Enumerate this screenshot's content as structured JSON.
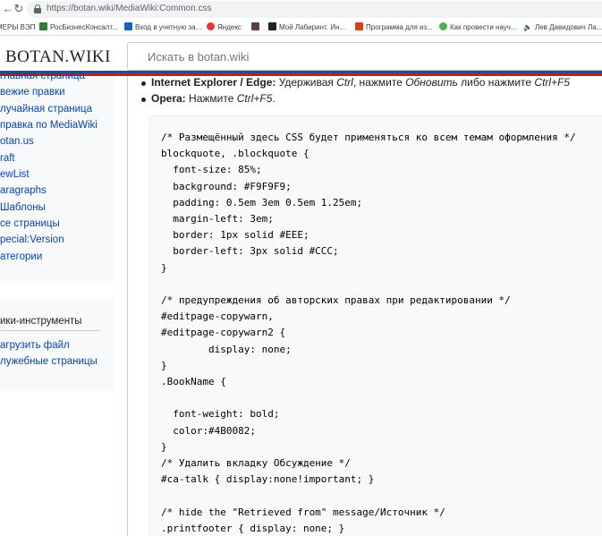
{
  "browser": {
    "url": "https://botan.wiki/MediaWiki:Common.css",
    "bookmarks": [
      {
        "label": "МЕРЫ ВЭП",
        "icon": "bookmark-folder-icon",
        "color": "#ffffff"
      },
      {
        "label": "РосБизнесКонсалт...",
        "icon": "rbc-icon",
        "color": "#2e7d32"
      },
      {
        "label": "Вход в учетную за...",
        "icon": "bank-icon",
        "color": "#1565c0"
      },
      {
        "label": "Яндекс",
        "icon": "yandex-icon",
        "color": "#e53935"
      },
      {
        "label": "",
        "icon": "photo-icon",
        "color": "#5d4037"
      },
      {
        "label": "Мой Лабиринт. Ин...",
        "icon": "labirint-icon",
        "color": "#212121"
      },
      {
        "label": "Программа для из...",
        "icon": "program-icon",
        "color": "#d84315"
      },
      {
        "label": "Как провести науч...",
        "icon": "google-icon",
        "color": "#4caf50"
      },
      {
        "label": "Лев Давидович Ла...",
        "icon": "audio-icon",
        "color": "#455a64"
      }
    ]
  },
  "site": {
    "logo": "BOTAN.WIKI",
    "search_placeholder": "Искать в botan.wiki"
  },
  "sidebar": {
    "nav": [
      "главная страница",
      "вежие правки",
      "лучайная страница",
      "правка по MediaWiki",
      "otan.us",
      "raft",
      "ewList",
      "aragraphs",
      "Шаблоны",
      "се страницы",
      "pecial:Version",
      "атегории"
    ],
    "tools_heading": "ики-инструменты",
    "tools": [
      "агрузить файл",
      "лужебные страницы"
    ]
  },
  "content": {
    "bullet1": {
      "bold": "Internet Explorer / Edge:",
      "text1": " Удерживая ",
      "em1": "Ctrl",
      "text2": ", нажмите ",
      "em2": "Обновить",
      "text3": " либо нажмите ",
      "em3": "Ctrl+F5"
    },
    "bullet2": {
      "bold": "Opera:",
      "text1": " Нажмите ",
      "em1": "Ctrl+F5",
      "text2": "."
    },
    "code": "/* Размещённый здесь CSS будет применяться ко всем темам оформления */\nblockquote, .blockquote {\n  font-size: 85%;\n  background: #F9F9F9;\n  padding: 0.5em 3em 0.5em 1.25em;\n  margin-left: 3em;\n  border: 1px solid #EEE;\n  border-left: 3px solid #CCC;\n}\n\n/* предупреждения об авторских правах при редактировании */\n#editpage-copywarn,\n#editpage-copywarn2 {\n        display: none;\n}\n.BookName {\n\n  font-weight: bold;\n  color:#4B0082;\n}\n/* Удалить вкладку Обсуждение */\n#ca-talk { display:none!important; }\n\n/* hide the \"Retrieved from\" message/Источник */\n.printfooter { display: none; }"
  }
}
